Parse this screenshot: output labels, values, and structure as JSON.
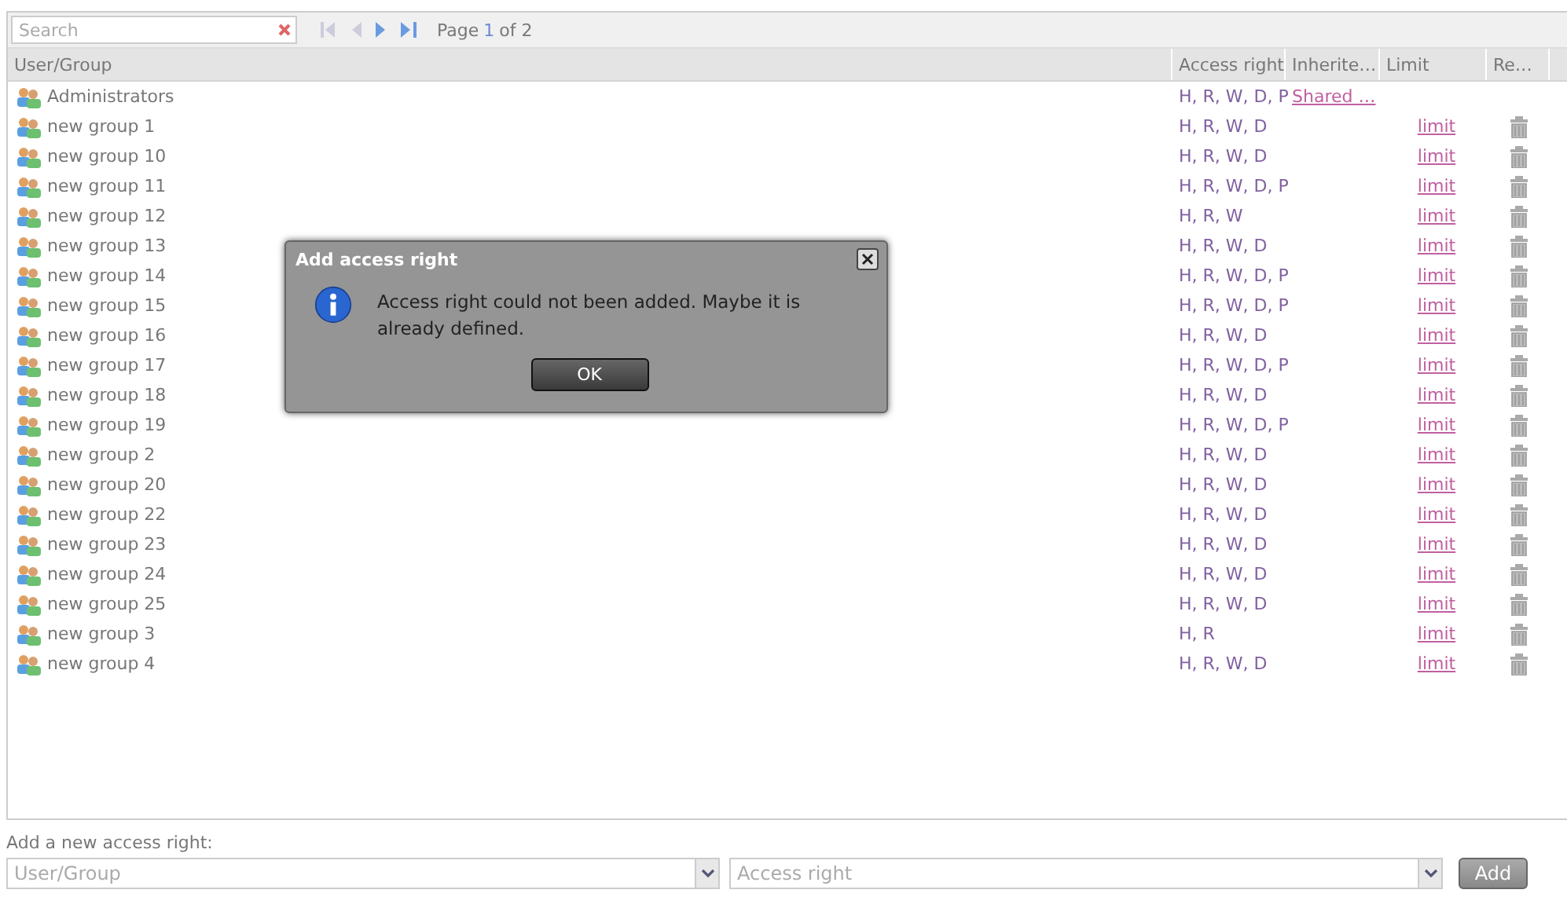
{
  "toolbar": {
    "search": {
      "placeholder": "Search"
    },
    "page_label": "Page",
    "page_current": "1",
    "page_of": "of 2"
  },
  "table": {
    "columns": [
      "User/Group",
      "Access right",
      "Inherite…",
      "Limit",
      "Re…"
    ],
    "rows": [
      {
        "name": "Administrators",
        "rights": "H, R, W, D, P",
        "inherited": "Shared …",
        "removable": false
      },
      {
        "name": "new group 1",
        "rights": "H, R, W, D",
        "limit": "limit",
        "removable": true
      },
      {
        "name": "new group 10",
        "rights": "H, R, W, D",
        "limit": "limit",
        "removable": true
      },
      {
        "name": "new group 11",
        "rights": "H, R, W, D, P",
        "limit": "limit",
        "removable": true
      },
      {
        "name": "new group 12",
        "rights": "H, R, W",
        "limit": "limit",
        "removable": true
      },
      {
        "name": "new group 13",
        "rights": "H, R, W, D",
        "limit": "limit",
        "removable": true
      },
      {
        "name": "new group 14",
        "rights": "H, R, W, D, P",
        "limit": "limit",
        "removable": true
      },
      {
        "name": "new group 15",
        "rights": "H, R, W, D, P",
        "limit": "limit",
        "removable": true
      },
      {
        "name": "new group 16",
        "rights": "H, R, W, D",
        "limit": "limit",
        "removable": true
      },
      {
        "name": "new group 17",
        "rights": "H, R, W, D, P",
        "limit": "limit",
        "removable": true
      },
      {
        "name": "new group 18",
        "rights": "H, R, W, D",
        "limit": "limit",
        "removable": true
      },
      {
        "name": "new group 19",
        "rights": "H, R, W, D, P",
        "limit": "limit",
        "removable": true
      },
      {
        "name": "new group 2",
        "rights": "H, R, W, D",
        "limit": "limit",
        "removable": true
      },
      {
        "name": "new group 20",
        "rights": "H, R, W, D",
        "limit": "limit",
        "removable": true
      },
      {
        "name": "new group 22",
        "rights": "H, R, W, D",
        "limit": "limit",
        "removable": true
      },
      {
        "name": "new group 23",
        "rights": "H, R, W, D",
        "limit": "limit",
        "removable": true
      },
      {
        "name": "new group 24",
        "rights": "H, R, W, D",
        "limit": "limit",
        "removable": true
      },
      {
        "name": "new group 25",
        "rights": "H, R, W, D",
        "limit": "limit",
        "removable": true
      },
      {
        "name": "new group 3",
        "rights": "H, R",
        "limit": "limit",
        "removable": true
      },
      {
        "name": "new group 4",
        "rights": "H, R, W, D",
        "limit": "limit",
        "removable": true
      }
    ]
  },
  "add_form": {
    "label": "Add a new access right:",
    "user_group": {
      "placeholder": "User/Group"
    },
    "access_right": {
      "placeholder": "Access right"
    },
    "button": "Add"
  },
  "dialog": {
    "title": "Add access right",
    "message": "Access right could not been added. Maybe it is already defined.",
    "button": "OK"
  }
}
